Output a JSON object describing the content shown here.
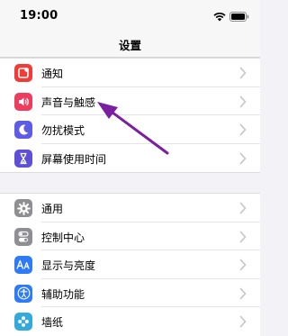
{
  "status_bar": {
    "time": "19:00"
  },
  "nav": {
    "title": "设置"
  },
  "group1": [
    {
      "label": "通知",
      "icon": "notifications-icon",
      "color": "#f23b36"
    },
    {
      "label": "声音与触感",
      "icon": "sound-icon",
      "color": "#ef3b5e"
    },
    {
      "label": "勿扰模式",
      "icon": "moon-icon",
      "color": "#5e5ce6"
    },
    {
      "label": "屏幕使用时间",
      "icon": "hourglass-icon",
      "color": "#5e4fd9"
    }
  ],
  "group2": [
    {
      "label": "通用",
      "icon": "gear-icon",
      "color": "#8e8e93"
    },
    {
      "label": "控制中心",
      "icon": "toggles-icon",
      "color": "#8e8e93"
    },
    {
      "label": "显示与亮度",
      "icon": "display-aa-icon",
      "color": "#2f7bf6"
    },
    {
      "label": "辅助功能",
      "icon": "accessibility-icon",
      "color": "#2f7bf6"
    },
    {
      "label": "墙纸",
      "icon": "wallpaper-icon",
      "color": "#34aadc"
    }
  ],
  "annotation": {
    "arrow_color": "#7a1fa0"
  }
}
